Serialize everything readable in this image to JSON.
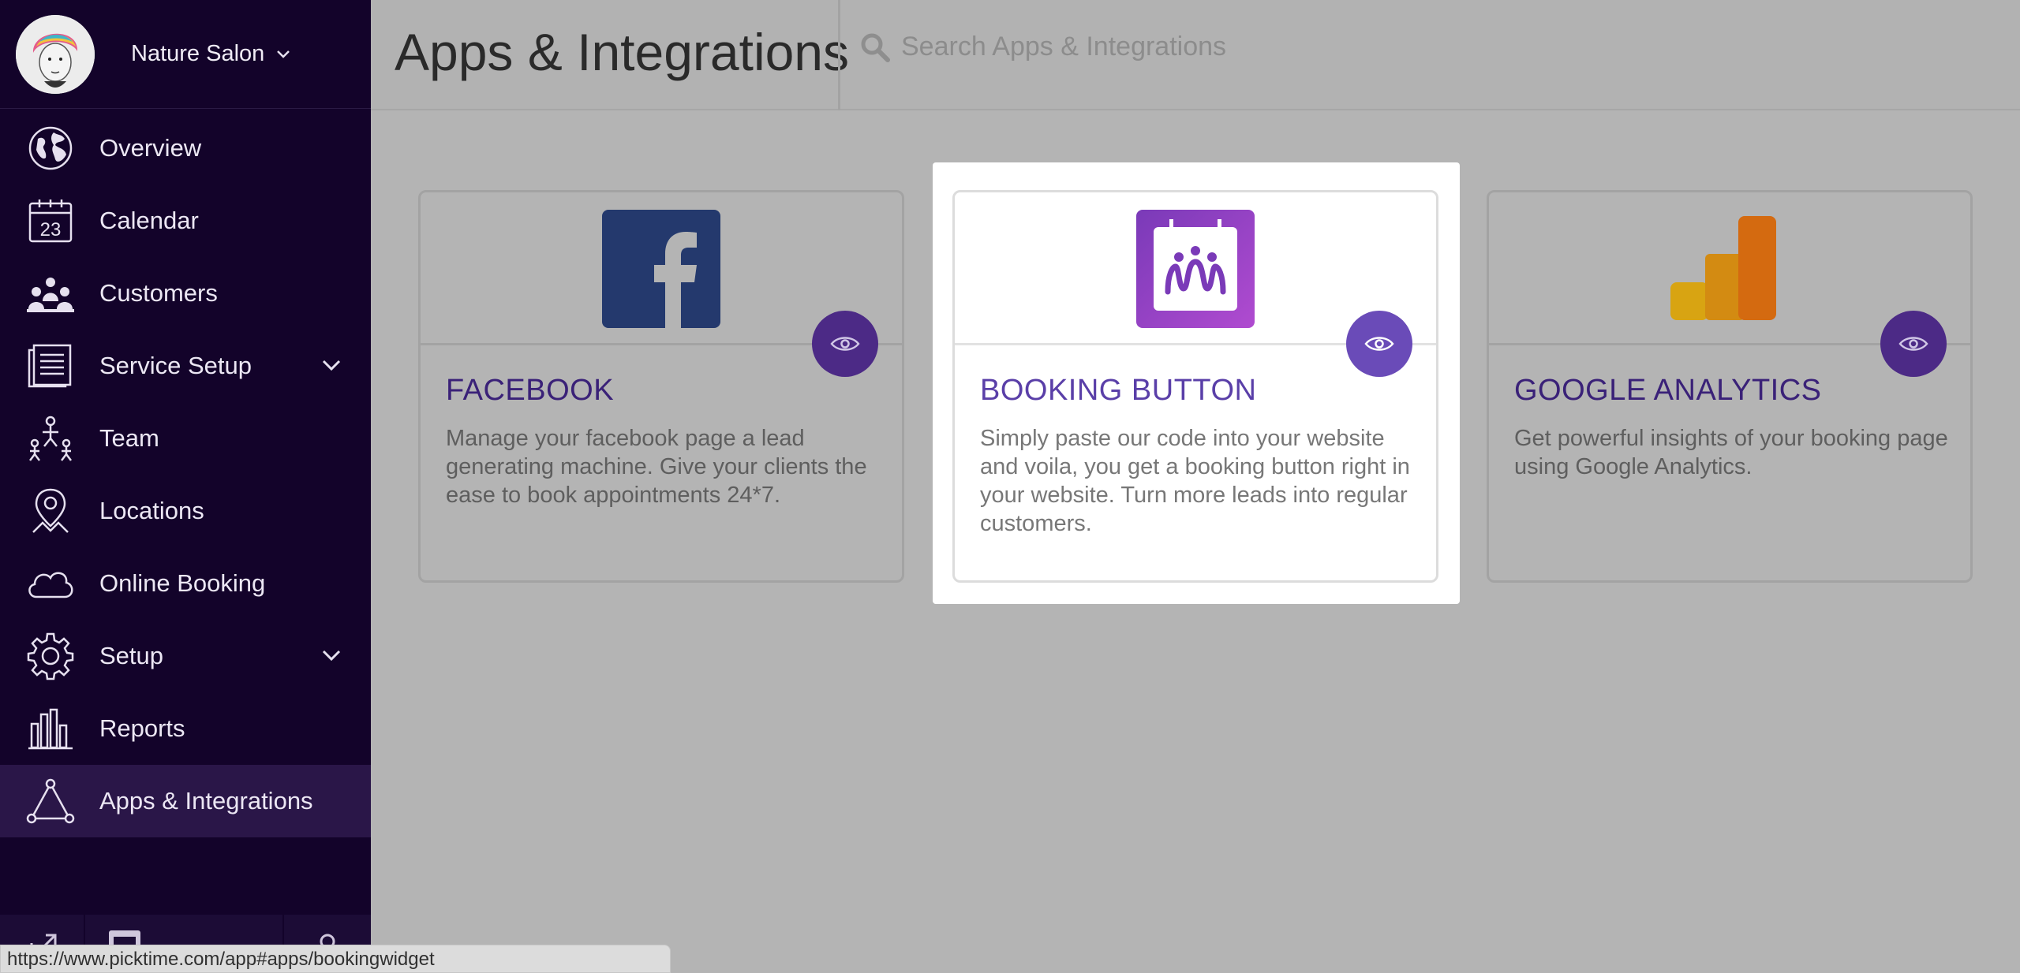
{
  "sidebar": {
    "account": {
      "name": "Nature Salon"
    },
    "items": [
      {
        "label": "Overview",
        "icon": "globe-icon"
      },
      {
        "label": "Calendar",
        "icon": "calendar-icon",
        "badge": "23"
      },
      {
        "label": "Customers",
        "icon": "customers-icon"
      },
      {
        "label": "Service Setup",
        "icon": "service-list-icon",
        "has_submenu": true
      },
      {
        "label": "Team",
        "icon": "team-icon"
      },
      {
        "label": "Locations",
        "icon": "location-pin-icon"
      },
      {
        "label": "Online Booking",
        "icon": "cloud-icon"
      },
      {
        "label": "Setup",
        "icon": "gear-icon",
        "has_submenu": true
      },
      {
        "label": "Reports",
        "icon": "bar-chart-icon"
      },
      {
        "label": "Apps & Integrations",
        "icon": "triangle-nodes-icon",
        "active": true
      }
    ]
  },
  "header": {
    "title": "Apps & Integrations",
    "search_placeholder": "Search Apps & Integrations"
  },
  "cards": [
    {
      "title": "FACEBOOK",
      "description": "Manage your facebook page a lead generating machine. Give your clients the ease to book appointments 24*7.",
      "icon": "facebook-logo-icon"
    },
    {
      "title": "BOOKING BUTTON",
      "description": "Simply paste our code into your website and voila, you get a booking button right in your website. Turn more leads into regular customers.",
      "icon": "booking-button-logo-icon",
      "highlighted": true
    },
    {
      "title": "GOOGLE ANALYTICS",
      "description": "Get powerful insights of your booking page using Google Analytics.",
      "icon": "google-analytics-logo-icon"
    }
  ],
  "status_bar": {
    "url": "https://www.picktime.com/app#apps/bookingwidget"
  },
  "colors": {
    "sidebar_bg": "#13032a",
    "accent_purple": "#6a4bb8",
    "facebook_blue": "#24396d",
    "analytics_orange": "#d46a10",
    "analytics_yellow": "#d8a412"
  }
}
